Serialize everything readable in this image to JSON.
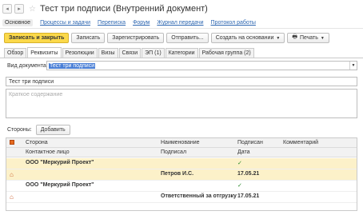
{
  "window": {
    "title": "Тест три подписи (Внутренний документ)",
    "back_icon": "arrow-left-icon",
    "forward_icon": "arrow-right-icon",
    "favorite_icon": "star-icon"
  },
  "nav_links": [
    "Основное",
    "Процессы и задачи",
    "Переписка",
    "Форум",
    "Журнал передачи",
    "Протокол работы"
  ],
  "toolbar": {
    "save_close": "Записать и закрыть",
    "save": "Записать",
    "register": "Зарегистрировать",
    "send": "Отправить...",
    "create_based": "Создать на основании",
    "print": "Печать",
    "accent_color": "#fbd94a"
  },
  "tabs": [
    "Обзор",
    "Реквизиты",
    "Резолюции",
    "Визы",
    "Связи",
    "ЭП (1)",
    "Категории",
    "Рабочая группа (2)"
  ],
  "active_tab": "Реквизиты",
  "form": {
    "doc_type_label": "Вид документа:",
    "doc_type_value": "Тест три подписи",
    "subject_value": "Тест три подписи",
    "summary_placeholder": "Краткое содержание",
    "sides_label": "Стороны:",
    "add_button": "Добавить"
  },
  "grid": {
    "headers": {
      "side": "Сторона",
      "contact": "Контактное лицо",
      "name": "Наименование",
      "signer": "Подписал",
      "signed": "Подписан",
      "date": "Дата",
      "comment": "Комментарий"
    },
    "rows": [
      {
        "side": "ООО \"Меркурий Проект\"",
        "signer": "Петров И.С.",
        "signed": "✓",
        "date": "17.05.21"
      },
      {
        "side": "ООО \"Меркурий Проект\"",
        "signer": "Ответственный за отгрузку",
        "signed": "✓",
        "date": "17.05.21"
      }
    ]
  }
}
